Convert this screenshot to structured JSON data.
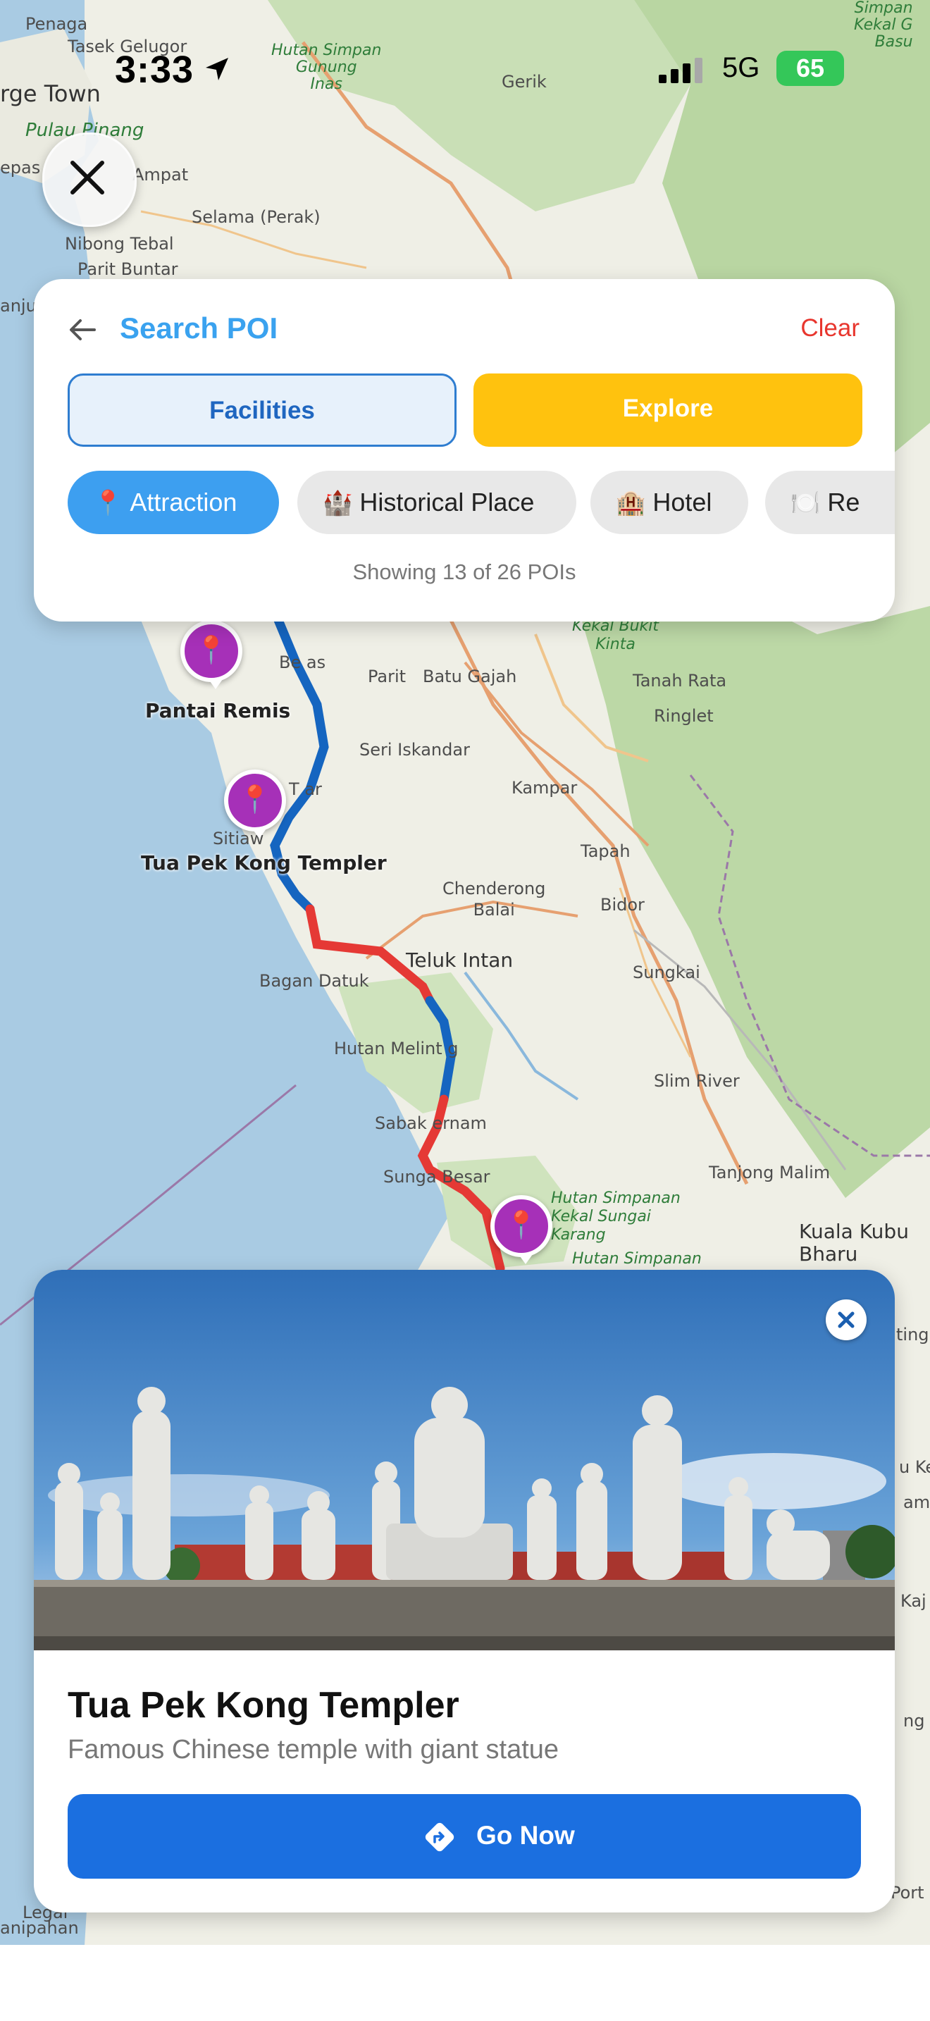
{
  "status_bar": {
    "time": "3:33",
    "network": "5G",
    "battery": "65"
  },
  "map_labels": {
    "penaga": "Penaga",
    "tasek_gelugor": "Tasek Gelugor",
    "hutan_simpan_gunung_inas": "Hutan Simpan\nGunung\nInas",
    "gerik": "Gerik",
    "kekal_g": "Simpan\nKekal G\nBasu",
    "george_town": "rge Town",
    "pulau_pinang": "Pulau Pinang",
    "ampat": "Ampat",
    "epas": "epas",
    "selama": "Selama (Perak)",
    "nibong_tebal": "Nibong Tebal",
    "parit_buntar": "Parit Buntar",
    "anjung": "anjun",
    "kekal_bukit_kinta": "Kekal Bukit\nKinta",
    "parit": "Parit",
    "batu_gajah": "Batu Gajah",
    "tanah_rata": "Tanah Rata",
    "ringlet": "Ringlet",
    "bemas": "Be  as",
    "seri_iskandar": "Seri Iskandar",
    "kampar": "Kampar",
    "tapah": "Tapah",
    "chenderong_balai": "Chenderong\nBalai",
    "bidor": "Bidor",
    "teluk_intan": "Teluk Intan",
    "bagan_datuk": "Bagan Datuk",
    "sungkai": "Sungkai",
    "hutan_melintang": "Hutan Melint  g",
    "slim_river": "Slim River",
    "sabak_bernam": "Sabak  ernam",
    "sungai_besar": "Sunga  Besar",
    "tanjong_malim": "Tanjong Malim",
    "hutan_simpanan": "Hutan Simpanan\nKekal Sungai\nKarang",
    "hutan_simpanan_2": "Hutan Simpanan",
    "kuala_kubu": "Kuala Kubu\nBharu",
    "tawar": "T  ar",
    "sitiawan": "Sitiaw",
    "ting": "ting",
    "u_ke": "u Ke",
    "amp": "amp",
    "kaj": "Kaj",
    "ng": "ng",
    "port": "Port",
    "legal": "Legal",
    "anipanan": "anipahan"
  },
  "search_card": {
    "title": "Search POI",
    "clear_label": "Clear",
    "tabs": {
      "facilities": "Facilities",
      "explore": "Explore"
    },
    "chips": [
      {
        "emoji": "📍",
        "label": "Attraction"
      },
      {
        "emoji": "🏰",
        "label": "Historical Place"
      },
      {
        "emoji": "🏨",
        "label": "Hotel"
      },
      {
        "emoji": "🍽️",
        "label": "Re"
      }
    ],
    "count_text": "Showing 13 of 26 POIs"
  },
  "pins": {
    "pin_1_icon": "📍",
    "pin_1_label": "Pantai Remis",
    "pin_2_icon": "📍",
    "pin_2_label": "Tua Pek Kong Templer",
    "pin_3_icon": "📍"
  },
  "poi_detail": {
    "title": "Tua Pek Kong Templer",
    "description": "Famous Chinese temple with giant statue",
    "go_label": "Go Now"
  },
  "icons": [
    "location-arrow-icon",
    "signal-icon",
    "battery-icon",
    "close-icon",
    "back-arrow-icon",
    "map-pin-icon",
    "directions-icon"
  ],
  "colors": {
    "accent_blue": "#3d9ff0",
    "explore_yellow": "#ffc20e",
    "go_button": "#1b6fe0",
    "clear_red": "#e8362e",
    "pin_purple": "#a630b8",
    "route_blue": "#1565c0",
    "route_red": "#e53935"
  }
}
